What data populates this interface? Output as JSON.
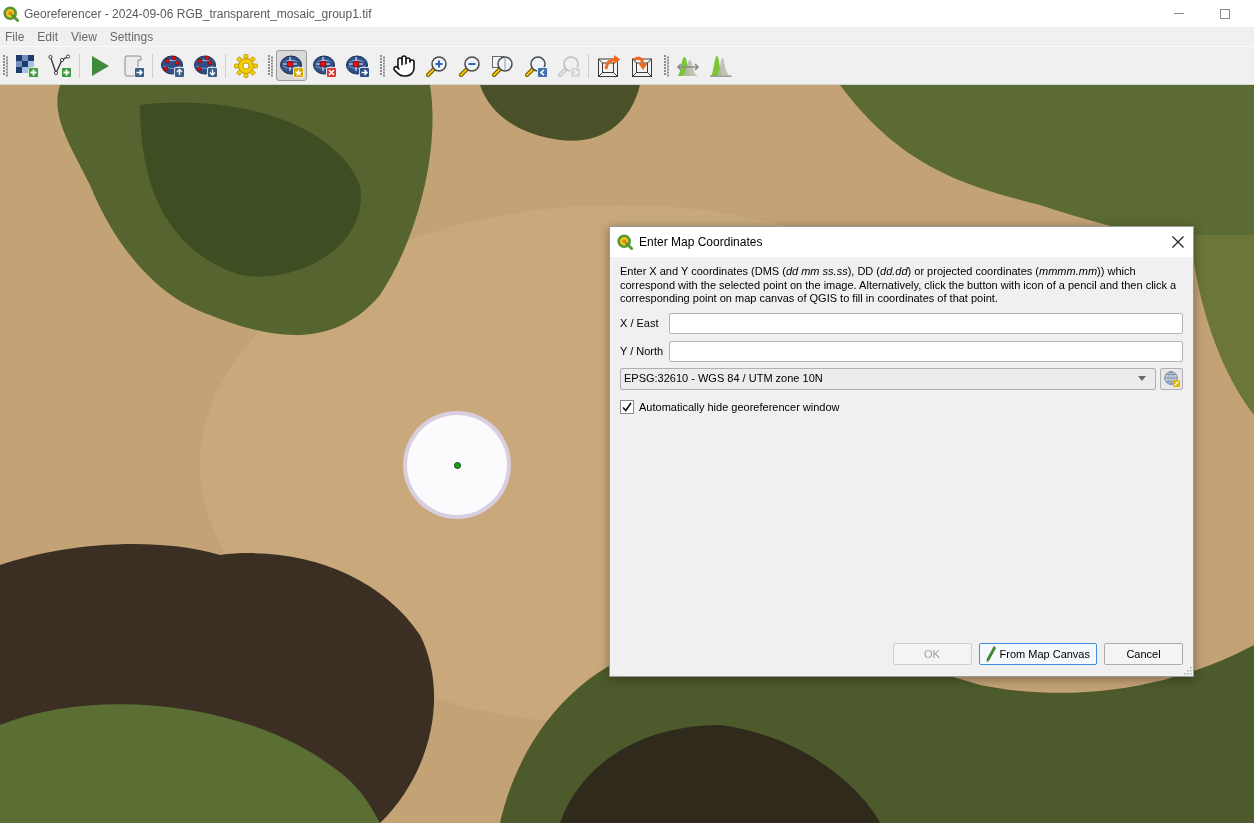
{
  "window": {
    "title": "Georeferencer - 2024-09-06 RGB_transparent_mosaic_group1.tif"
  },
  "menu": [
    "File",
    "Edit",
    "View",
    "Settings"
  ],
  "toolbars": [
    {
      "groups": [
        [
          {
            "kind": "raster",
            "selected": false,
            "disabled": false
          },
          {
            "kind": "vector",
            "selected": false,
            "disabled": false
          }
        ],
        [
          {
            "kind": "run",
            "selected": false,
            "disabled": false
          },
          {
            "kind": "script",
            "selected": false,
            "disabled": false
          }
        ],
        [
          {
            "kind": "load",
            "selected": false,
            "disabled": false
          },
          {
            "kind": "save",
            "selected": false,
            "disabled": false
          }
        ],
        [
          {
            "kind": "settings",
            "selected": false,
            "disabled": false
          }
        ]
      ]
    },
    {
      "groups": [
        [
          {
            "kind": "add",
            "selected": true,
            "disabled": false
          },
          {
            "kind": "delete",
            "selected": false,
            "disabled": false
          },
          {
            "kind": "move",
            "selected": false,
            "disabled": false
          }
        ]
      ]
    },
    {
      "groups": [
        [
          {
            "kind": "pan",
            "selected": false,
            "disabled": false
          },
          {
            "kind": "zoom-in",
            "selected": false,
            "disabled": false
          },
          {
            "kind": "zoom-out",
            "selected": false,
            "disabled": false
          },
          {
            "kind": "zoom-layer",
            "selected": false,
            "disabled": false
          },
          {
            "kind": "zoom-last",
            "selected": false,
            "disabled": false
          },
          {
            "kind": "zoom-next",
            "selected": false,
            "disabled": true
          }
        ],
        [
          {
            "kind": "link-out",
            "selected": false,
            "disabled": false
          },
          {
            "kind": "link-in",
            "selected": false,
            "disabled": false
          }
        ]
      ]
    },
    {
      "groups": [
        [
          {
            "kind": "stretch",
            "selected": false,
            "disabled": false
          },
          {
            "kind": "histogram",
            "selected": false,
            "disabled": false
          }
        ]
      ]
    }
  ],
  "dialog": {
    "title": "Enter Map Coordinates",
    "description": "Enter X and Y coordinates (DMS (*dd mm ss.ss*), DD (*dd.dd*) or projected coordinates (*mmmm.mm*)) which correspond with the selected point on the image. Alternatively, click the button with icon of a pencil and then click a corresponding point on map canvas of QGIS to fill in coordinates of that point.",
    "fields": [
      {
        "label": "X / East"
      },
      {
        "label": "Y / North"
      }
    ],
    "crs": "EPSG:32610 - WGS 84 / UTM zone 10N",
    "auto_hide": {
      "label": "Automatically hide georeferencer window",
      "checked": true
    },
    "buttons": [
      {
        "label": "OK",
        "kind": "text",
        "disabled": true,
        "focused": false
      },
      {
        "label": "From Map Canvas",
        "kind": "icon-text",
        "disabled": false,
        "focused": true
      },
      {
        "label": "Cancel",
        "kind": "text",
        "disabled": false,
        "focused": false
      }
    ]
  }
}
